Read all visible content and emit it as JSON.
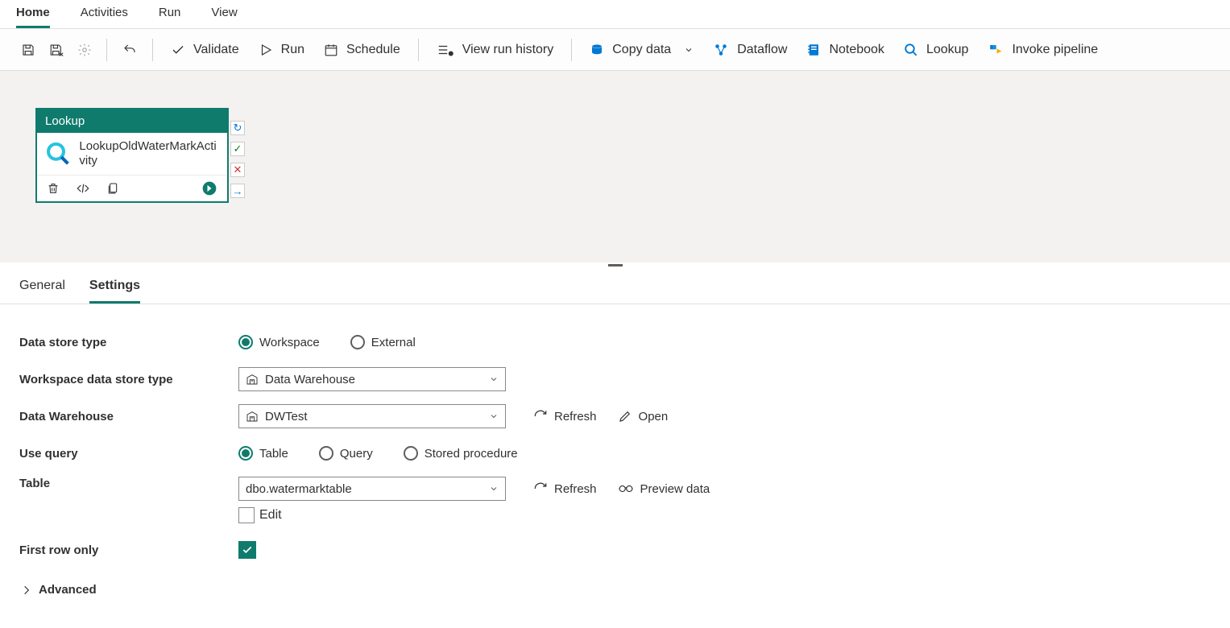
{
  "topnav": {
    "items": [
      {
        "label": "Home",
        "active": true
      },
      {
        "label": "Activities"
      },
      {
        "label": "Run"
      },
      {
        "label": "View"
      }
    ]
  },
  "toolbar": {
    "validate": "Validate",
    "run": "Run",
    "schedule": "Schedule",
    "view_run_history": "View run history",
    "copy_data": "Copy data",
    "dataflow": "Dataflow",
    "notebook": "Notebook",
    "lookup": "Lookup",
    "invoke_pipeline": "Invoke pipeline"
  },
  "activity": {
    "type_label": "Lookup",
    "name": "LookupOldWaterMarkActivity"
  },
  "detail_tabs": {
    "general": "General",
    "settings": "Settings"
  },
  "form": {
    "data_store_type_label": "Data store type",
    "workspace_option": "Workspace",
    "external_option": "External",
    "ws_ds_type_label": "Workspace data store type",
    "ws_ds_type_value": "Data Warehouse",
    "dw_label": "Data Warehouse",
    "dw_value": "DWTest",
    "refresh": "Refresh",
    "open": "Open",
    "use_query_label": "Use query",
    "table_option": "Table",
    "query_option": "Query",
    "sp_option": "Stored procedure",
    "table_label": "Table",
    "table_value": "dbo.watermarktable",
    "preview_data": "Preview data",
    "edit_label": "Edit",
    "first_row_label": "First row only",
    "advanced": "Advanced"
  }
}
